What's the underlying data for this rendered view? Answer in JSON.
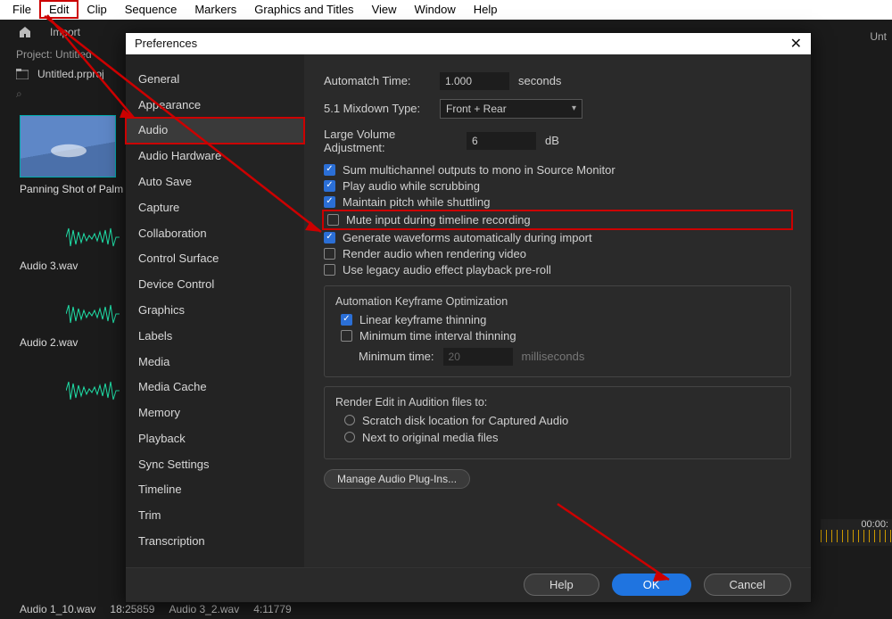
{
  "menubar": [
    "File",
    "Edit",
    "Clip",
    "Sequence",
    "Markers",
    "Graphics and Titles",
    "View",
    "Window",
    "Help"
  ],
  "menubar_highlight_index": 1,
  "app": {
    "import": "Import",
    "right_cut": "Unt",
    "project": "Project: Untitled",
    "file": "Untitled.prproj",
    "thumb_label": "Panning Shot of Palm",
    "audio3": "Audio 3.wav",
    "audio2": "Audio 2.wav",
    "bottom": {
      "a": "Audio 1_10.wav",
      "b": "18:25859",
      "c": "Audio 3_2.wav",
      "d": "4:11779"
    },
    "timecode": "00:00:"
  },
  "dialog": {
    "title": "Preferences",
    "sidebar": [
      "General",
      "Appearance",
      "Audio",
      "Audio Hardware",
      "Auto Save",
      "Capture",
      "Collaboration",
      "Control Surface",
      "Device Control",
      "Graphics",
      "Labels",
      "Media",
      "Media Cache",
      "Memory",
      "Playback",
      "Sync Settings",
      "Timeline",
      "Trim",
      "Transcription"
    ],
    "selected_index": 2,
    "automatch_label": "Automatch Time:",
    "automatch_value": "1.000",
    "automatch_unit": "seconds",
    "mixdown_label": "5.1 Mixdown Type:",
    "mixdown_value": "Front + Rear",
    "volume_label": "Large Volume Adjustment:",
    "volume_value": "6",
    "volume_unit": "dB",
    "checks": [
      {
        "label": "Sum multichannel outputs to mono in Source Monitor",
        "checked": true
      },
      {
        "label": "Play audio while scrubbing",
        "checked": true
      },
      {
        "label": "Maintain pitch while shuttling",
        "checked": true
      },
      {
        "label": "Mute input during timeline recording",
        "checked": false,
        "highlight": true
      },
      {
        "label": "Generate waveforms automatically during import",
        "checked": true
      },
      {
        "label": "Render audio when rendering video",
        "checked": false
      },
      {
        "label": "Use legacy audio effect playback pre-roll",
        "checked": false
      }
    ],
    "group1": {
      "title": "Automation Keyframe Optimization",
      "linear": {
        "label": "Linear keyframe thinning",
        "checked": true
      },
      "minint": {
        "label": "Minimum time interval thinning",
        "checked": false
      },
      "mintime_label": "Minimum time:",
      "mintime_value": "20",
      "mintime_unit": "milliseconds"
    },
    "group2": {
      "title": "Render Edit in Audition files to:",
      "r1": "Scratch disk location for Captured Audio",
      "r2": "Next to original media files"
    },
    "plugins_btn": "Manage Audio Plug-Ins...",
    "help": "Help",
    "ok": "OK",
    "cancel": "Cancel"
  }
}
